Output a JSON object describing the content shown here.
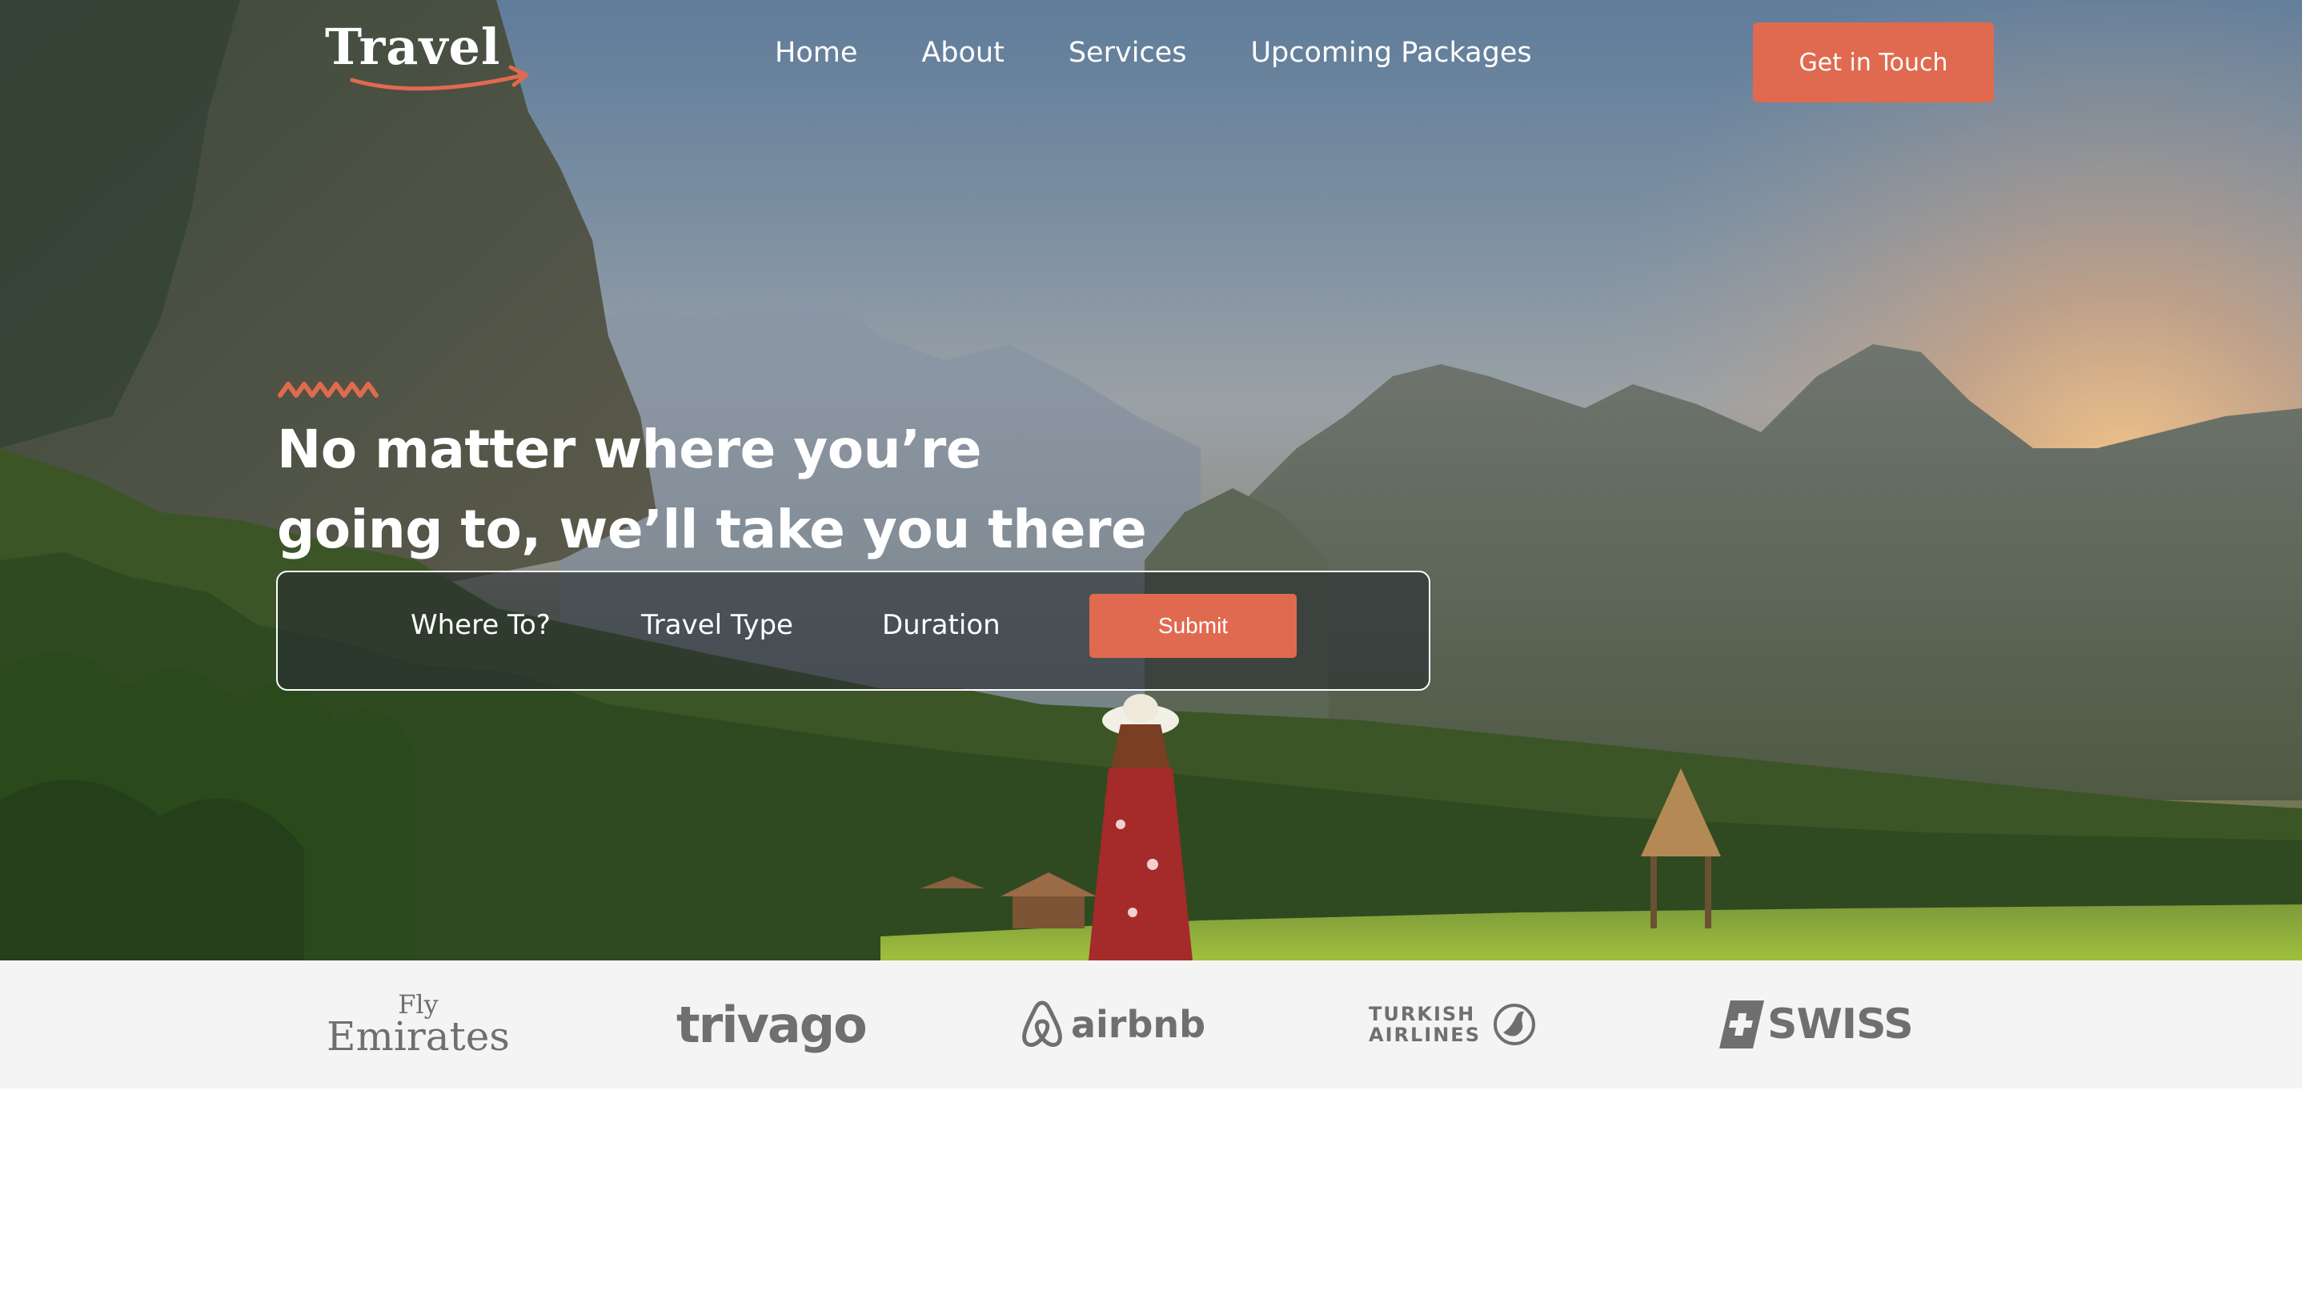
{
  "brand": {
    "logo_text": "Travel"
  },
  "nav": {
    "links": [
      {
        "label": "Home"
      },
      {
        "label": "About"
      },
      {
        "label": "Services"
      },
      {
        "label": "Upcoming Packages"
      }
    ],
    "cta_label": "Get in Touch"
  },
  "hero": {
    "headline_line1": "No matter where you’re",
    "headline_line2": "going to, we’ll take you there"
  },
  "search": {
    "fields": [
      {
        "label": "Where To?"
      },
      {
        "label": "Travel Type"
      },
      {
        "label": "Duration"
      }
    ],
    "submit_label": "Submit"
  },
  "partners": {
    "emirates_fly": "Fly",
    "emirates_name": "Emirates",
    "trivago": "trivago",
    "airbnb": "airbnb",
    "turkish_line1": "TURKISH",
    "turkish_line2": "AIRLINES",
    "swiss": "SWISS"
  },
  "colors": {
    "accent": "#e06a4f",
    "partner_strip_bg": "#f4f4f4",
    "partner_logo": "#6f6f6f"
  }
}
